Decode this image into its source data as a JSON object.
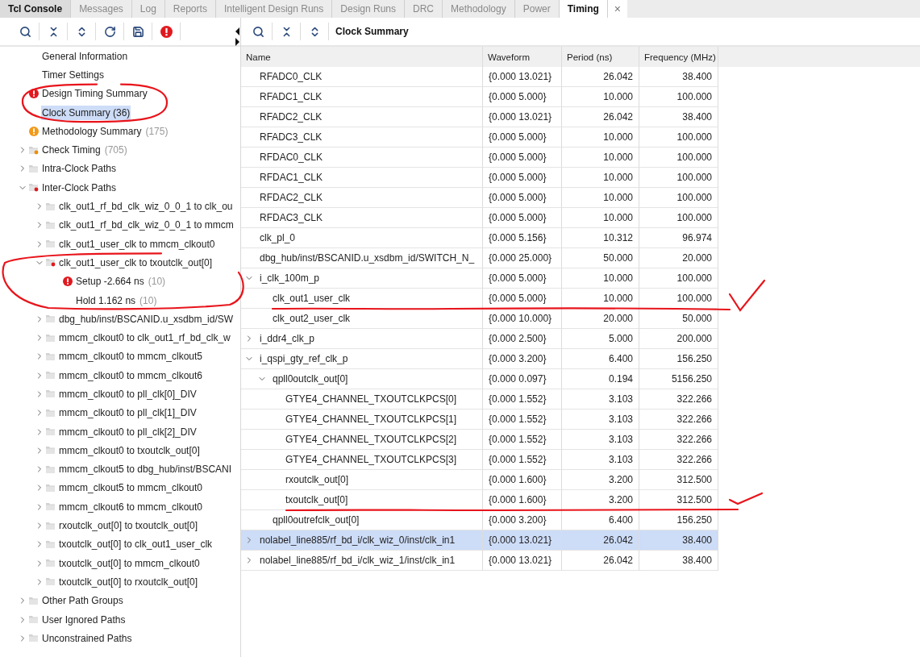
{
  "tabs": [
    {
      "label": "Tcl Console",
      "selected": false,
      "kind": "console"
    },
    {
      "label": "Messages",
      "selected": false,
      "kind": "view"
    },
    {
      "label": "Log",
      "selected": false,
      "kind": "view"
    },
    {
      "label": "Reports",
      "selected": false,
      "kind": "view"
    },
    {
      "label": "Intelligent Design Runs",
      "selected": false,
      "kind": "view"
    },
    {
      "label": "Design Runs",
      "selected": false,
      "kind": "view"
    },
    {
      "label": "DRC",
      "selected": false,
      "kind": "view"
    },
    {
      "label": "Methodology",
      "selected": false,
      "kind": "view"
    },
    {
      "label": "Power",
      "selected": false,
      "kind": "view"
    },
    {
      "label": "Timing",
      "selected": true,
      "kind": "view"
    }
  ],
  "close_label": "×",
  "tree": [
    {
      "label": "General Information",
      "kind": "page",
      "selected": false
    },
    {
      "label": "Timer Settings",
      "kind": "page",
      "selected": false
    },
    {
      "label": "Design Timing Summary",
      "kind": "error",
      "selected": false
    },
    {
      "label": "Clock Summary (36)",
      "kind": "page",
      "selected": true
    },
    {
      "label": "Methodology Summary",
      "count": "(175)",
      "kind": "warning",
      "selected": false
    },
    {
      "label": "Check Timing",
      "count": "(705)",
      "kind": "folder-warning",
      "selected": false,
      "expanded": false
    },
    {
      "label": "Intra-Clock Paths",
      "kind": "folder",
      "selected": false,
      "expanded": false
    },
    {
      "label": "Inter-Clock Paths",
      "kind": "folder-error",
      "selected": false,
      "expanded": true,
      "children": [
        {
          "label": "clk_out1_rf_bd_clk_wiz_0_0_1 to clk_ou",
          "kind": "folder",
          "selected": false,
          "expanded": false
        },
        {
          "label": "clk_out1_rf_bd_clk_wiz_0_0_1 to mmcm",
          "kind": "folder",
          "selected": false,
          "expanded": false
        },
        {
          "label": "clk_out1_user_clk to mmcm_clkout0",
          "kind": "folder",
          "selected": false,
          "expanded": false
        },
        {
          "label": "clk_out1_user_clk to txoutclk_out[0]",
          "kind": "folder-error",
          "selected": false,
          "expanded": true,
          "children": [
            {
              "label": "Setup -2.664 ns",
              "count": "(10)",
              "kind": "error",
              "selected": false
            },
            {
              "label": "Hold 1.162 ns",
              "count": "(10)",
              "kind": "page",
              "selected": false
            }
          ]
        },
        {
          "label": "dbg_hub/inst/BSCANID.u_xsdbm_id/SW",
          "kind": "folder",
          "selected": false,
          "expanded": false
        },
        {
          "label": "mmcm_clkout0 to clk_out1_rf_bd_clk_w",
          "kind": "folder",
          "selected": false,
          "expanded": false
        },
        {
          "label": "mmcm_clkout0 to mmcm_clkout5",
          "kind": "folder",
          "selected": false,
          "expanded": false
        },
        {
          "label": "mmcm_clkout0 to mmcm_clkout6",
          "kind": "folder",
          "selected": false,
          "expanded": false
        },
        {
          "label": "mmcm_clkout0 to pll_clk[0]_DIV",
          "kind": "folder",
          "selected": false,
          "expanded": false
        },
        {
          "label": "mmcm_clkout0 to pll_clk[1]_DIV",
          "kind": "folder",
          "selected": false,
          "expanded": false
        },
        {
          "label": "mmcm_clkout0 to pll_clk[2]_DIV",
          "kind": "folder",
          "selected": false,
          "expanded": false
        },
        {
          "label": "mmcm_clkout0 to txoutclk_out[0]",
          "kind": "folder",
          "selected": false,
          "expanded": false
        },
        {
          "label": "mmcm_clkout5 to dbg_hub/inst/BSCANI",
          "kind": "folder",
          "selected": false,
          "expanded": false
        },
        {
          "label": "mmcm_clkout5 to mmcm_clkout0",
          "kind": "folder",
          "selected": false,
          "expanded": false
        },
        {
          "label": "mmcm_clkout6 to mmcm_clkout0",
          "kind": "folder",
          "selected": false,
          "expanded": false
        },
        {
          "label": "rxoutclk_out[0] to txoutclk_out[0]",
          "kind": "folder",
          "selected": false,
          "expanded": false
        },
        {
          "label": "txoutclk_out[0] to clk_out1_user_clk",
          "kind": "folder",
          "selected": false,
          "expanded": false
        },
        {
          "label": "txoutclk_out[0] to mmcm_clkout0",
          "kind": "folder",
          "selected": false,
          "expanded": false
        },
        {
          "label": "txoutclk_out[0] to rxoutclk_out[0]",
          "kind": "folder",
          "selected": false,
          "expanded": false
        }
      ]
    },
    {
      "label": "Other Path Groups",
      "kind": "folder",
      "selected": false,
      "expanded": false
    },
    {
      "label": "User Ignored Paths",
      "kind": "folder",
      "selected": false,
      "expanded": false
    },
    {
      "label": "Unconstrained Paths",
      "kind": "folder",
      "selected": false,
      "expanded": false
    }
  ],
  "report": {
    "title": "Clock Summary",
    "columns": [
      "Name",
      "Waveform",
      "Period (ns)",
      "Frequency (MHz)"
    ],
    "rows": [
      {
        "name": "RFADC0_CLK",
        "waveform": "{0.000 13.021}",
        "period": "26.042",
        "frequency": "38.400",
        "selected": false
      },
      {
        "name": "RFADC1_CLK",
        "waveform": "{0.000 5.000}",
        "period": "10.000",
        "frequency": "100.000",
        "selected": false
      },
      {
        "name": "RFADC2_CLK",
        "waveform": "{0.000 13.021}",
        "period": "26.042",
        "frequency": "38.400",
        "selected": false
      },
      {
        "name": "RFADC3_CLK",
        "waveform": "{0.000 5.000}",
        "period": "10.000",
        "frequency": "100.000",
        "selected": false
      },
      {
        "name": "RFDAC0_CLK",
        "waveform": "{0.000 5.000}",
        "period": "10.000",
        "frequency": "100.000",
        "selected": false
      },
      {
        "name": "RFDAC1_CLK",
        "waveform": "{0.000 5.000}",
        "period": "10.000",
        "frequency": "100.000",
        "selected": false
      },
      {
        "name": "RFDAC2_CLK",
        "waveform": "{0.000 5.000}",
        "period": "10.000",
        "frequency": "100.000",
        "selected": false
      },
      {
        "name": "RFDAC3_CLK",
        "waveform": "{0.000 5.000}",
        "period": "10.000",
        "frequency": "100.000",
        "selected": false
      },
      {
        "name": "clk_pl_0",
        "waveform": "{0.000 5.156}",
        "period": "10.312",
        "frequency": "96.974",
        "selected": false
      },
      {
        "name": "dbg_hub/inst/BSCANID.u_xsdbm_id/SWITCH_N_",
        "waveform": "{0.000 25.000}",
        "period": "50.000",
        "frequency": "20.000",
        "selected": false
      },
      {
        "name": "i_clk_100m_p",
        "waveform": "{0.000 5.000}",
        "period": "10.000",
        "frequency": "100.000",
        "selected": false,
        "expanded": true,
        "children": [
          {
            "name": "clk_out1_user_clk",
            "waveform": "{0.000 5.000}",
            "period": "10.000",
            "frequency": "100.000",
            "selected": false
          },
          {
            "name": "clk_out2_user_clk",
            "waveform": "{0.000 10.000}",
            "period": "20.000",
            "frequency": "50.000",
            "selected": false
          }
        ]
      },
      {
        "name": "i_ddr4_clk_p",
        "waveform": "{0.000 2.500}",
        "period": "5.000",
        "frequency": "200.000",
        "selected": false,
        "expanded": false
      },
      {
        "name": "i_qspi_gty_ref_clk_p",
        "waveform": "{0.000 3.200}",
        "period": "6.400",
        "frequency": "156.250",
        "selected": false,
        "expanded": true,
        "children": [
          {
            "name": "qpll0outclk_out[0]",
            "waveform": "{0.000 0.097}",
            "period": "0.194",
            "frequency": "5156.250",
            "selected": false,
            "expanded": true,
            "children": [
              {
                "name": "GTYE4_CHANNEL_TXOUTCLKPCS[0]",
                "waveform": "{0.000 1.552}",
                "period": "3.103",
                "frequency": "322.266",
                "selected": false
              },
              {
                "name": "GTYE4_CHANNEL_TXOUTCLKPCS[1]",
                "waveform": "{0.000 1.552}",
                "period": "3.103",
                "frequency": "322.266",
                "selected": false
              },
              {
                "name": "GTYE4_CHANNEL_TXOUTCLKPCS[2]",
                "waveform": "{0.000 1.552}",
                "period": "3.103",
                "frequency": "322.266",
                "selected": false
              },
              {
                "name": "GTYE4_CHANNEL_TXOUTCLKPCS[3]",
                "waveform": "{0.000 1.552}",
                "period": "3.103",
                "frequency": "322.266",
                "selected": false
              },
              {
                "name": "rxoutclk_out[0]",
                "waveform": "{0.000 1.600}",
                "period": "3.200",
                "frequency": "312.500",
                "selected": false
              },
              {
                "name": "txoutclk_out[0]",
                "waveform": "{0.000 1.600}",
                "period": "3.200",
                "frequency": "312.500",
                "selected": false
              }
            ]
          },
          {
            "name": "qpll0outrefclk_out[0]",
            "waveform": "{0.000 3.200}",
            "period": "6.400",
            "frequency": "156.250",
            "selected": false
          }
        ]
      },
      {
        "name": "nolabel_line885/rf_bd_i/clk_wiz_0/inst/clk_in1",
        "waveform": "{0.000 13.021}",
        "period": "26.042",
        "frequency": "38.400",
        "selected": true,
        "expanded": false
      },
      {
        "name": "nolabel_line885/rf_bd_i/clk_wiz_1/inst/clk_in1",
        "waveform": "{0.000 13.021}",
        "period": "26.042",
        "frequency": "38.400",
        "selected": false,
        "expanded": false
      }
    ]
  }
}
